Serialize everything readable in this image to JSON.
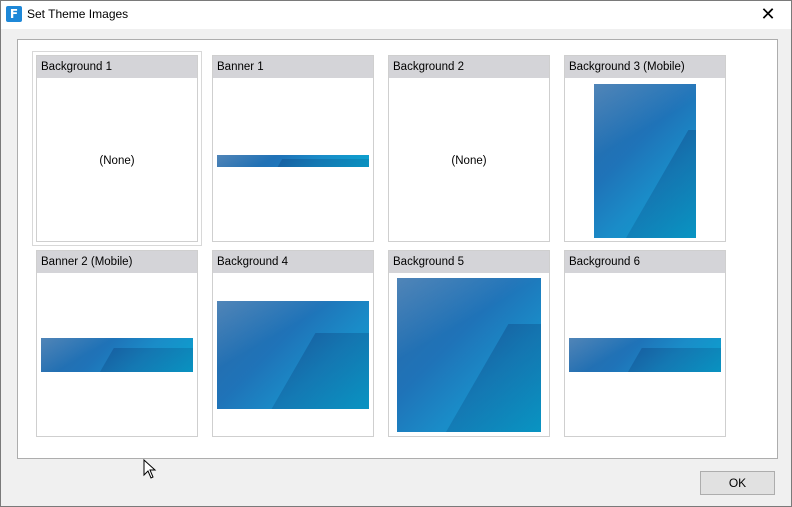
{
  "window": {
    "title": "Set Theme Images",
    "app_icon_glyph": "F",
    "close_glyph": "✕"
  },
  "tiles": [
    {
      "label": "Background 1",
      "content": "(None)"
    },
    {
      "label": "Banner 1"
    },
    {
      "label": "Background 2",
      "content": "(None)"
    },
    {
      "label": "Background 3 (Mobile)"
    },
    {
      "label": "Banner 2 (Mobile)"
    },
    {
      "label": "Background 4"
    },
    {
      "label": "Background 5"
    },
    {
      "label": "Background 6"
    }
  ],
  "buttons": {
    "ok": "OK"
  },
  "colors": {
    "header_bg": "#d4d4d8",
    "image_blue": "#1f73b8",
    "app_icon_bg": "#1e88d8"
  }
}
